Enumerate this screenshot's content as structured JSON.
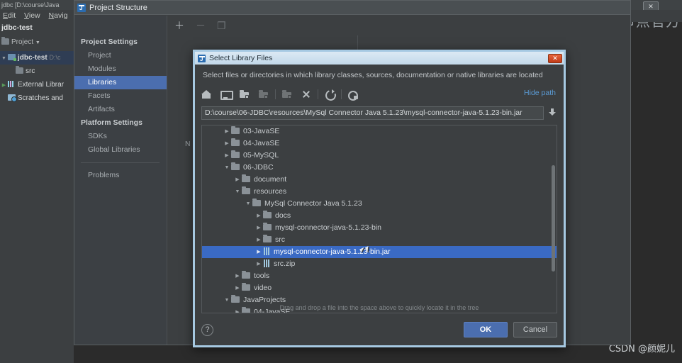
{
  "ide": {
    "window_title": "jdbc [D:\\course\\Java",
    "menu": [
      {
        "label": "Edit",
        "mnemonic": "E"
      },
      {
        "label": "View",
        "mnemonic": "V"
      },
      {
        "label": "Navig",
        "mnemonic": "N"
      }
    ],
    "project_label": "jdbc-test",
    "tool_window": "Project",
    "tree": [
      {
        "arrow": "▼",
        "icon": "module-icon",
        "name": "jdbc-test",
        "suffix": "D:\\c",
        "bold": true,
        "selected": true
      },
      {
        "arrow": "",
        "icon": "folder-icon",
        "name": "src",
        "suffix": "",
        "bold": false,
        "selected": false
      },
      {
        "arrow": "▶",
        "icon": "library-icon",
        "name": "External Librar",
        "suffix": "",
        "bold": false,
        "selected": false
      },
      {
        "arrow": "",
        "icon": "scratch-icon",
        "name": "Scratches and",
        "suffix": "",
        "bold": false,
        "selected": false
      }
    ],
    "watermark_top": "动力节点官方",
    "watermark_bottom": "CSDN @颜妮儿",
    "close_glyph": "✕"
  },
  "project_structure": {
    "title": "Project Structure",
    "nav": {
      "back": "←",
      "forward": "→"
    },
    "toolbar": [
      {
        "name": "add-button",
        "glyph": "＋",
        "enabled": true
      },
      {
        "name": "remove-button",
        "glyph": "－",
        "enabled": false
      },
      {
        "name": "copy-button",
        "glyph": "❐",
        "enabled": false
      }
    ],
    "sidebar": [
      {
        "type": "group",
        "label": "Project Settings"
      },
      {
        "type": "item",
        "label": "Project",
        "selected": false
      },
      {
        "type": "item",
        "label": "Modules",
        "selected": false
      },
      {
        "type": "item",
        "label": "Libraries",
        "selected": true
      },
      {
        "type": "item",
        "label": "Facets",
        "selected": false
      },
      {
        "type": "item",
        "label": "Artifacts",
        "selected": false
      },
      {
        "type": "group",
        "label": "Platform Settings"
      },
      {
        "type": "item",
        "label": "SDKs",
        "selected": false
      },
      {
        "type": "item",
        "label": "Global Libraries",
        "selected": false
      },
      {
        "type": "sep",
        "label": ""
      },
      {
        "type": "item",
        "label": "Problems",
        "selected": false
      }
    ],
    "empty_hint": "N"
  },
  "dialog": {
    "title": "Select Library Files",
    "close_glyph": "✕",
    "description": "Select files or directories in which library classes, sources, documentation or native libraries are located",
    "toolbar": [
      {
        "name": "home-icon",
        "class": "ic-home",
        "enabled": true
      },
      {
        "name": "desktop-icon",
        "class": "ic-desktop",
        "enabled": true
      },
      {
        "name": "new-folder-icon",
        "class": "ic-folder",
        "enabled": true
      },
      {
        "name": "new-subfolder-icon",
        "class": "ic-folder",
        "enabled": false
      },
      {
        "name": "up-folder-icon",
        "class": "ic-folder",
        "enabled": false
      },
      {
        "name": "delete-icon",
        "class": "ic-x",
        "enabled": true
      },
      {
        "name": "refresh-icon",
        "class": "ic-refresh",
        "enabled": true
      },
      {
        "name": "show-hidden-icon",
        "class": "ic-hidden",
        "enabled": true
      }
    ],
    "hide_path_label": "Hide path",
    "path_value": "D:\\course\\06-JDBC\\resources\\MySql Connector Java 5.1.23\\mysql-connector-java-5.1.23-bin.jar",
    "tree": [
      {
        "indent": 1,
        "arrow": "▶",
        "icon": "folder",
        "label": "03-JavaSE",
        "selected": false
      },
      {
        "indent": 1,
        "arrow": "▶",
        "icon": "folder",
        "label": "04-JavaSE",
        "selected": false
      },
      {
        "indent": 1,
        "arrow": "▶",
        "icon": "folder",
        "label": "05-MySQL",
        "selected": false
      },
      {
        "indent": 1,
        "arrow": "▼",
        "icon": "folder",
        "label": "06-JDBC",
        "selected": false
      },
      {
        "indent": 2,
        "arrow": "▶",
        "icon": "folder",
        "label": "document",
        "selected": false
      },
      {
        "indent": 2,
        "arrow": "▼",
        "icon": "folder",
        "label": "resources",
        "selected": false
      },
      {
        "indent": 3,
        "arrow": "▼",
        "icon": "folder",
        "label": "MySql Connector Java 5.1.23",
        "selected": false
      },
      {
        "indent": 4,
        "arrow": "▶",
        "icon": "folder",
        "label": "docs",
        "selected": false
      },
      {
        "indent": 4,
        "arrow": "▶",
        "icon": "folder",
        "label": "mysql-connector-java-5.1.23-bin",
        "selected": false
      },
      {
        "indent": 4,
        "arrow": "▶",
        "icon": "folder",
        "label": "src",
        "selected": false
      },
      {
        "indent": 4,
        "arrow": "▶",
        "icon": "jar",
        "label": "mysql-connector-java-5.1.23-bin.jar",
        "selected": true
      },
      {
        "indent": 4,
        "arrow": "▶",
        "icon": "jar",
        "label": "src.zip",
        "selected": false
      },
      {
        "indent": 2,
        "arrow": "▶",
        "icon": "folder",
        "label": "tools",
        "selected": false
      },
      {
        "indent": 2,
        "arrow": "▶",
        "icon": "folder",
        "label": "video",
        "selected": false
      },
      {
        "indent": 1,
        "arrow": "▼",
        "icon": "folder",
        "label": "JavaProjects",
        "selected": false
      },
      {
        "indent": 2,
        "arrow": "▶",
        "icon": "folder",
        "label": "04-JavaSE",
        "selected": false
      }
    ],
    "drag_hint": "Drag and drop a file into the space above to quickly locate it in the tree",
    "help_glyph": "?",
    "ok_label": "OK",
    "cancel_label": "Cancel"
  },
  "colors": {
    "accent_selection": "#3a6ac4",
    "sidebar_selection": "#4b6eaf",
    "link": "#5b9bd5",
    "dialog_border": "#a6c9e2",
    "close_red": "#c03b19"
  }
}
